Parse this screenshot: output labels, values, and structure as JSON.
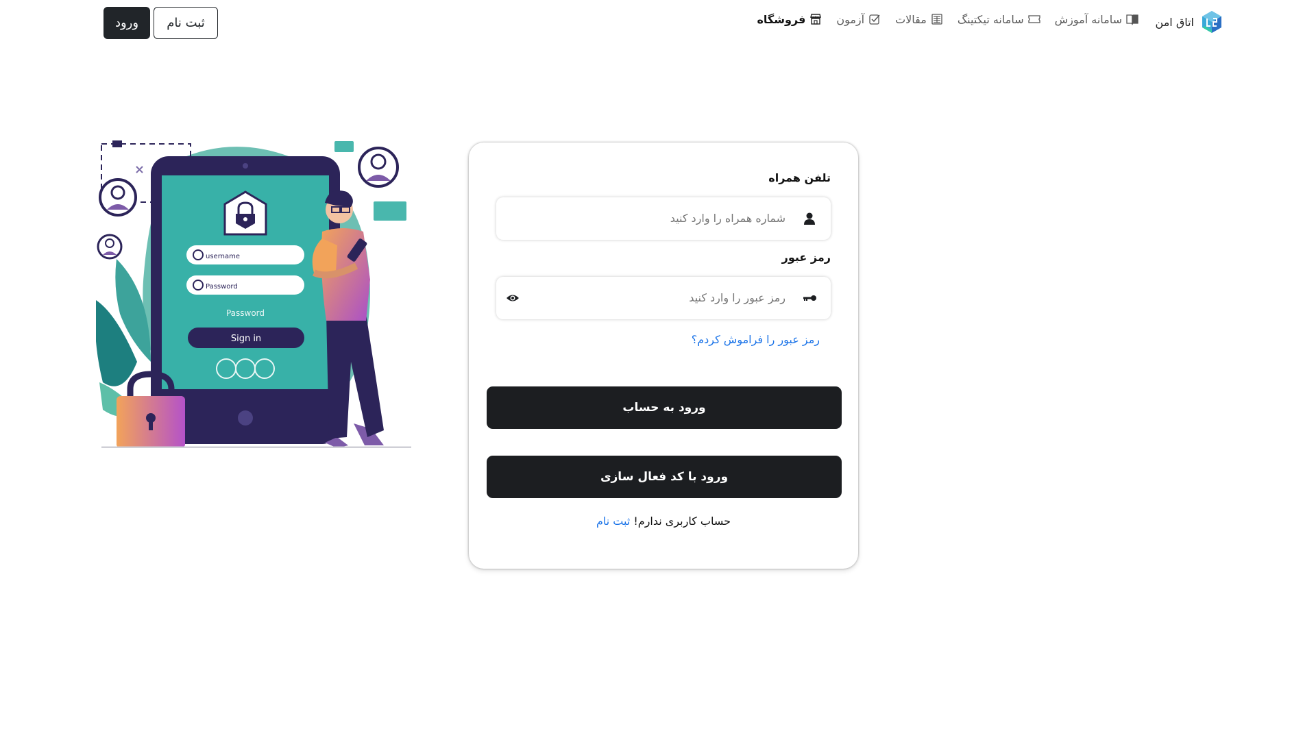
{
  "header": {
    "brand_name": "اتاق امن",
    "nav": [
      {
        "label": "فروشگاه",
        "icon": "store-icon",
        "active": true
      },
      {
        "label": "آزمون",
        "icon": "checkbox-icon",
        "active": false
      },
      {
        "label": "مقالات",
        "icon": "newspaper-icon",
        "active": false
      },
      {
        "label": "سامانه تیکتینگ",
        "icon": "ticket-icon",
        "active": false
      },
      {
        "label": "سامانه آموزش",
        "icon": "book-icon",
        "active": false
      }
    ],
    "login_label": "ورود",
    "register_label": "ثبت نام"
  },
  "illustration": {
    "username_text": "username",
    "password_field_text": "Password",
    "password_text": "Password",
    "signin_text": "Sign in"
  },
  "form": {
    "phone_label": "تلفن همراه",
    "phone_placeholder": "شماره همراه را وارد کنید",
    "password_label": "رمز عبور",
    "password_placeholder": "رمز عبور را وارد کنید",
    "forgot_link": "رمز عبور را فراموش کردم؟",
    "login_button": "ورود به حساب",
    "code_login_button": "ورود با کد فعال سازی",
    "no_account_text": "حساب کاربری ندارم!",
    "signup_link": "ثبت نام"
  },
  "colors": {
    "primary_dark": "#1c1e21",
    "link_blue": "#1a73e8",
    "illustration_teal": "#3ab0a8",
    "illustration_navy": "#2c2459"
  }
}
